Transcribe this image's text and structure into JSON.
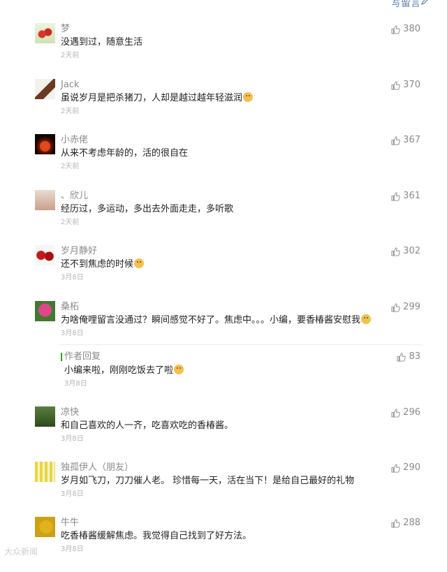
{
  "header": {
    "write_comment": "写留言"
  },
  "comments": [
    {
      "name": "梦",
      "text": "没遇到过，随意生活",
      "emoji": false,
      "time": "2天前",
      "likes": "380",
      "avatar": "avatar-1"
    },
    {
      "name": "Jack",
      "text": "虽说岁月是把杀猪刀，人却是越过越年轻滋润",
      "emoji": true,
      "time": "2天前",
      "likes": "370",
      "avatar": "avatar-2"
    },
    {
      "name": "小赤佬",
      "text": "从来不考虑年龄的，活的很自在",
      "emoji": false,
      "time": "2天前",
      "likes": "367",
      "avatar": "avatar-3"
    },
    {
      "name": "、欣儿",
      "text": "经历过，多运动，多出去外面走走，多听歌",
      "emoji": false,
      "time": "2天前",
      "likes": "361",
      "avatar": "avatar-4"
    },
    {
      "name": "岁月静好",
      "text": "还不到焦虑的时候",
      "emoji": true,
      "time": "3月8日",
      "likes": "302",
      "avatar": "avatar-5"
    },
    {
      "name": "桑柘",
      "text": "为啥俺哩留言没通过？瞬间感觉不好了。焦虑中。。。小编，要香椿酱安慰我",
      "emoji": true,
      "time": "3月8日",
      "likes": "299",
      "avatar": "avatar-6"
    },
    {
      "name": "凉快",
      "text": "和自己喜欢的人一齐，吃喜欢吃的香椿酱。",
      "emoji": false,
      "time": "3月8日",
      "likes": "296",
      "avatar": "avatar-7"
    },
    {
      "name": "独孤伊人（朋友）",
      "text": "岁月如飞刀，刀刀催人老。 珍惜每一天，活在当下！是给自己最好的礼物",
      "emoji": false,
      "time": "3月8日",
      "likes": "290",
      "avatar": "avatar-8"
    },
    {
      "name": "牛牛",
      "text": "吃香椿酱缓解焦虑。我觉得自己找到了好方法。",
      "emoji": false,
      "time": "3月8日",
      "likes": "288",
      "avatar": "avatar-9"
    }
  ],
  "author_reply": {
    "label": "作者回复",
    "text": "小编来啦，刚刚吃饭去了啦",
    "emoji": true,
    "time": "3月8日",
    "likes": "83"
  },
  "watermark": "大众新闻"
}
